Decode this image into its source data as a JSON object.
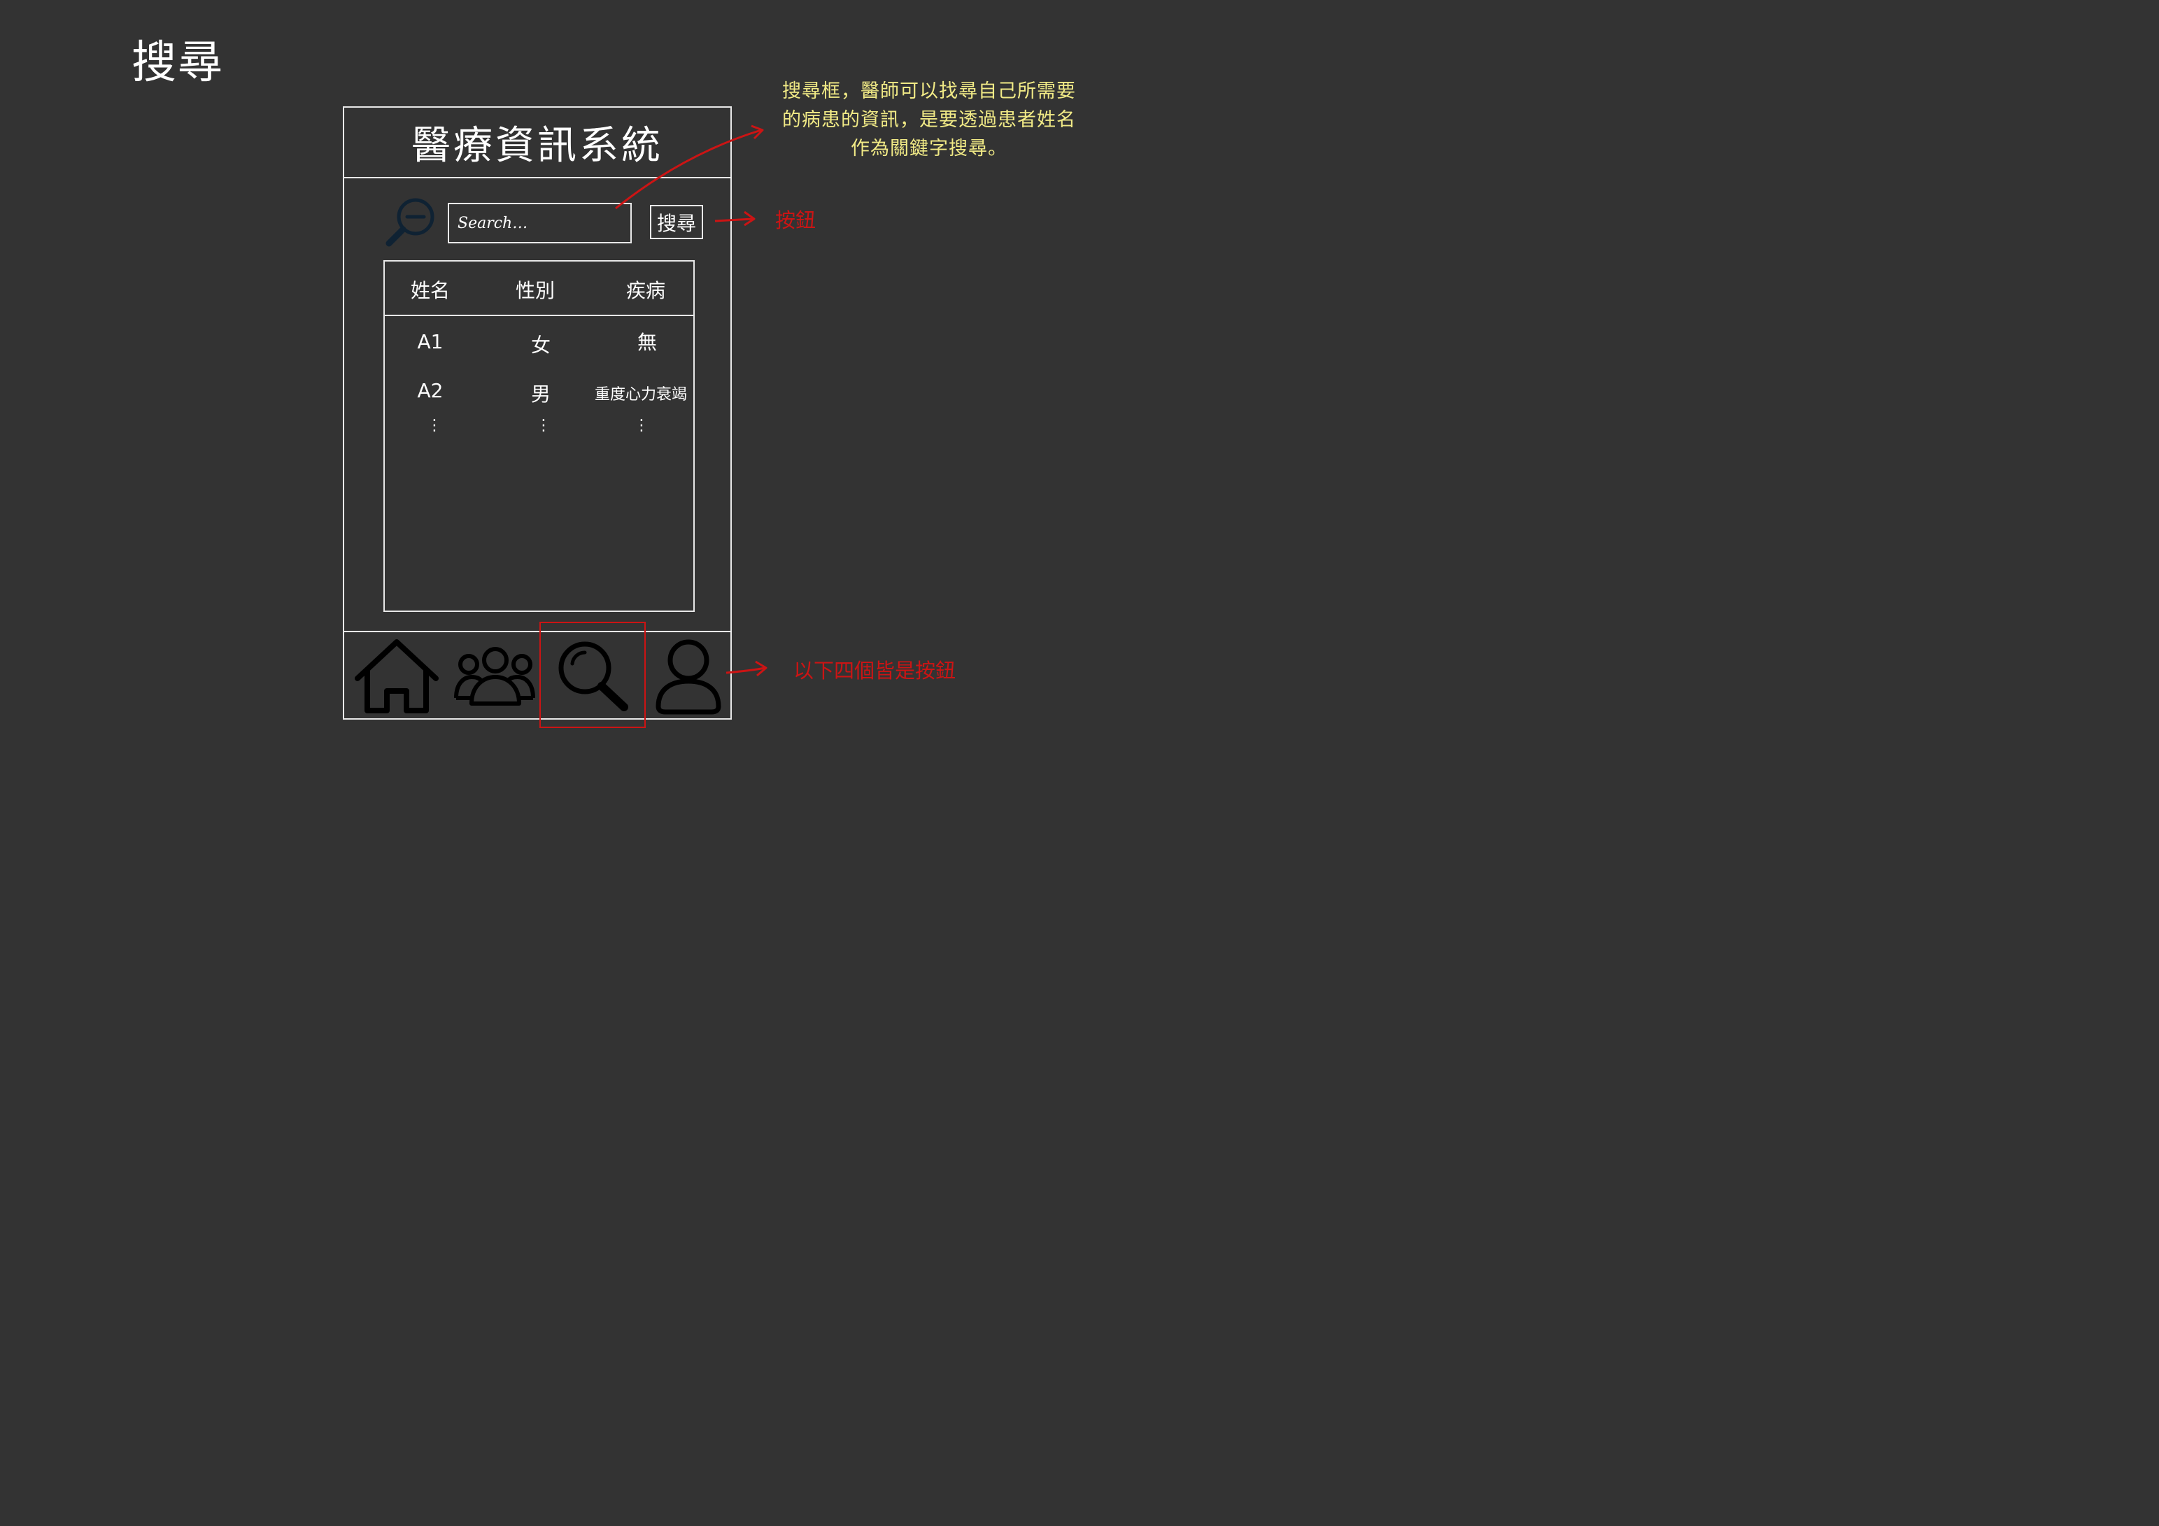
{
  "page_title": "搜尋",
  "app": {
    "title": "醫療資訊系統",
    "search": {
      "placeholder": "Search…",
      "button_label": "搜尋"
    },
    "table": {
      "headers": [
        "姓名",
        "性別",
        "疾病"
      ],
      "rows": [
        [
          "A1",
          "女",
          "無"
        ],
        [
          "A2",
          "男",
          "重度心力衰竭"
        ]
      ],
      "continuation": [
        "⋮",
        "⋮",
        "⋮"
      ]
    },
    "bottom_nav": [
      {
        "icon": "home-icon"
      },
      {
        "icon": "group-icon"
      },
      {
        "icon": "search-icon"
      },
      {
        "icon": "person-icon"
      }
    ]
  },
  "annotations": {
    "search_box_note": "搜尋框，醫師可以找尋自己所需要的病患的資訊，是要透過患者姓名作為關鍵字搜尋。",
    "button_note": "按鈕",
    "nav_note": "以下四個皆是按鈕"
  },
  "colors": {
    "background": "#333333",
    "line": "#e8e8e8",
    "annotation_red": "#cc1414",
    "annotation_yellow": "#f1ea86"
  }
}
